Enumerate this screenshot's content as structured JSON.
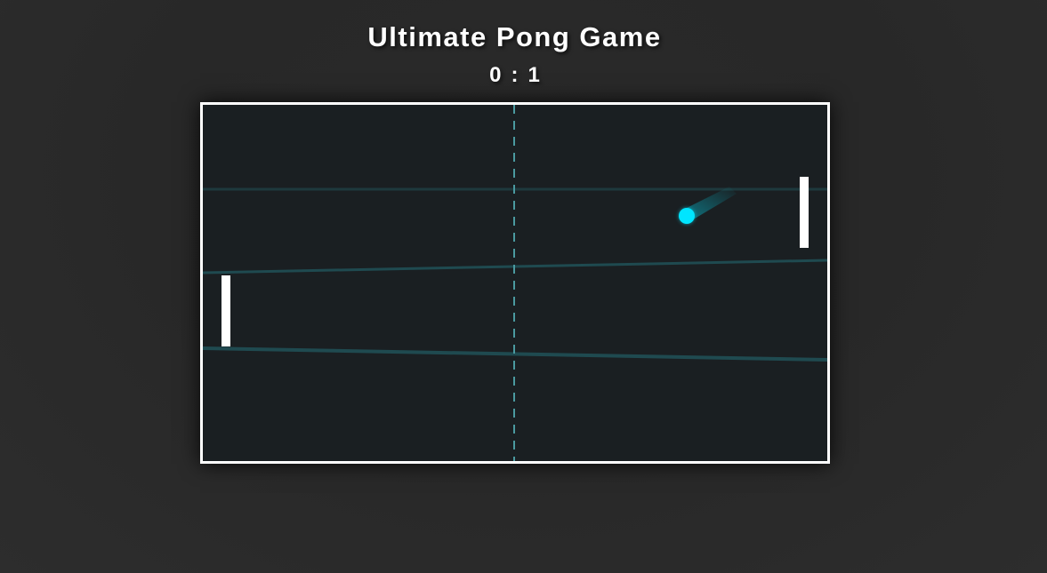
{
  "game": {
    "title": "Ultimate Pong Game",
    "score": {
      "left": "0",
      "separator": ":",
      "right": "1"
    }
  },
  "colors": {
    "ball": "#00e5ff",
    "paddle": "#ffffff",
    "court_border": "#ffffff",
    "court_background": "#1a1f22",
    "center_line": "#4a9aa0",
    "background_lines": "#1f4a50"
  },
  "icons": {
    "ball": "ball",
    "left_paddle": "paddle",
    "right_paddle": "paddle"
  }
}
